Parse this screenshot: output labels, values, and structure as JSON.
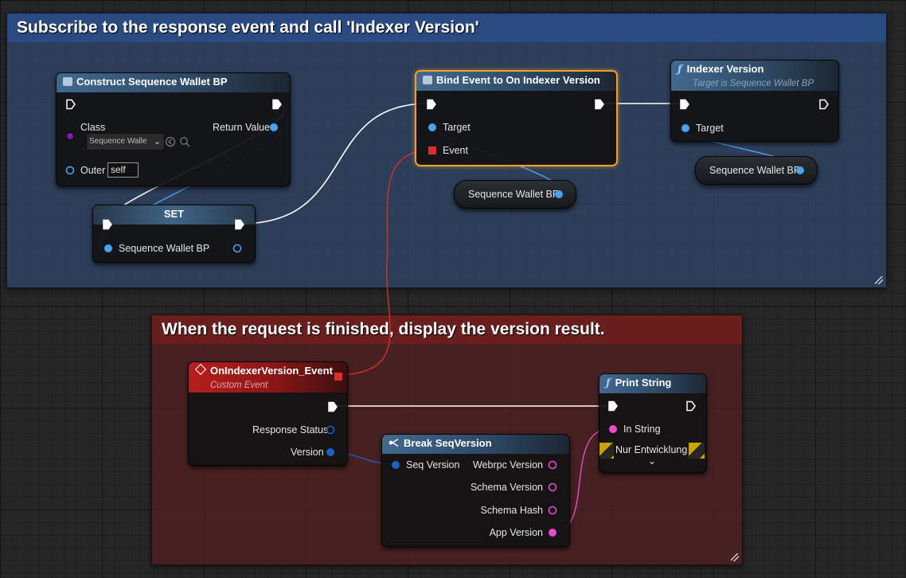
{
  "colors": {
    "exec": "#ffffff",
    "object": "#4aa3f0",
    "class": "#7a1fb5",
    "string": "#e94ad0",
    "delegate": "#d9302c",
    "selection": "#f1a02a",
    "comment_blue": "#2f4a6e",
    "comment_red": "#5a2424"
  },
  "comments": [
    {
      "title": "Subscribe to the response event and call 'Indexer Version'"
    },
    {
      "title": "When the request is finished, display the version result."
    }
  ],
  "construct": {
    "title": "Construct Sequence Wallet BP",
    "class_label": "Class",
    "class_value": "Sequence Walle",
    "return_label": "Return Value",
    "outer_label": "Outer",
    "outer_value": "self"
  },
  "set_node": {
    "title": "SET",
    "var_label": "Sequence Wallet BP"
  },
  "bind": {
    "title": "Bind Event to On Indexer Version",
    "target_label": "Target",
    "event_label": "Event"
  },
  "indexer": {
    "title": "Indexer Version",
    "subtitle": "Target is Sequence Wallet BP",
    "target_label": "Target"
  },
  "var_pills": [
    "Sequence Wallet BP",
    "Sequence Wallet BP"
  ],
  "event": {
    "title": "OnIndexerVersion_Event",
    "subtitle": "Custom Event",
    "response_status_label": "Response Status",
    "version_label": "Version"
  },
  "break": {
    "title": "Break SeqVersion",
    "input_label": "Seq Version",
    "outputs": [
      "Webrpc Version",
      "Schema Version",
      "Schema Hash",
      "App Version"
    ]
  },
  "print": {
    "title": "Print String",
    "in_string_label": "In String",
    "dev_only_label": "Nur Entwicklung"
  }
}
